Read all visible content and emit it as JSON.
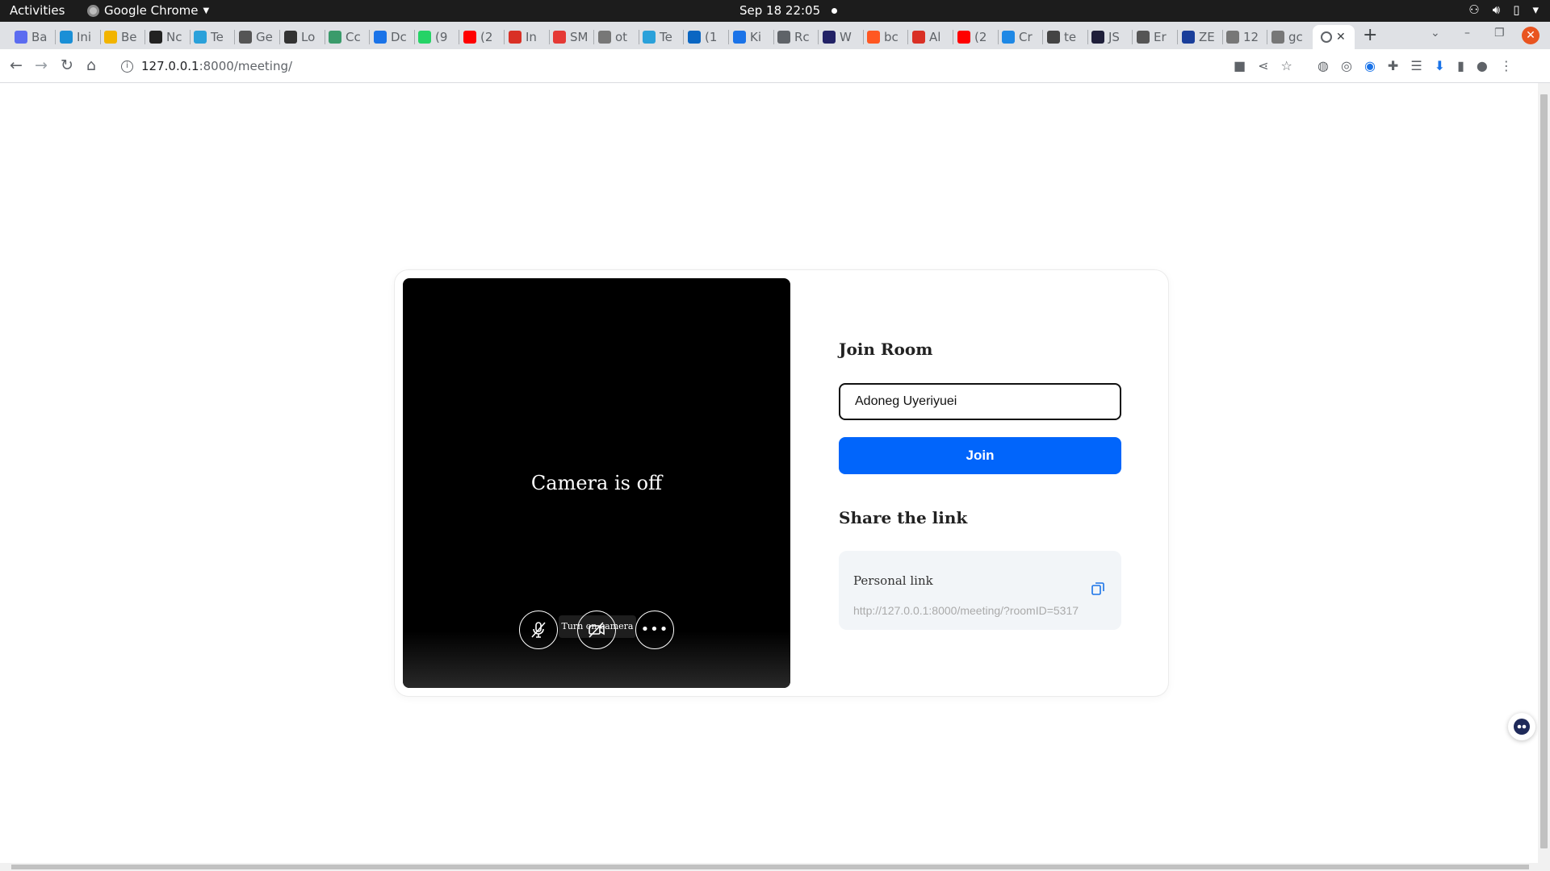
{
  "system": {
    "activities": "Activities",
    "app_name": "Google Chrome",
    "clock": "Sep 18  22:05"
  },
  "tabs": [
    {
      "label": "Ba",
      "color": "#5b6cf0"
    },
    {
      "label": "Ini",
      "color": "#1a8fd6"
    },
    {
      "label": "Be",
      "color": "#f2b400"
    },
    {
      "label": "Nc",
      "color": "#222222"
    },
    {
      "label": "Te",
      "color": "#2aa1da"
    },
    {
      "label": "Ge",
      "color": "#555555"
    },
    {
      "label": "Lo",
      "color": "#333333"
    },
    {
      "label": "Cc",
      "color": "#3a9b6b"
    },
    {
      "label": "Dc",
      "color": "#1a73e8"
    },
    {
      "label": "(9",
      "color": "#25d366"
    },
    {
      "label": "(2",
      "color": "#ff0000"
    },
    {
      "label": "In",
      "color": "#d93025"
    },
    {
      "label": "SM",
      "color": "#e53935"
    },
    {
      "label": "ot",
      "color": "#777777"
    },
    {
      "label": "Te",
      "color": "#2aa1da"
    },
    {
      "label": "(1",
      "color": "#0a66c2"
    },
    {
      "label": "Ki",
      "color": "#1a73e8"
    },
    {
      "label": "Rc",
      "color": "#5f6368"
    },
    {
      "label": "W",
      "color": "#222266"
    },
    {
      "label": "bc",
      "color": "#ff5722"
    },
    {
      "label": "Al",
      "color": "#d93025"
    },
    {
      "label": "(2",
      "color": "#ff0000"
    },
    {
      "label": "Cr",
      "color": "#1e88e5"
    },
    {
      "label": "te",
      "color": "#444444"
    },
    {
      "label": "JS",
      "color": "#1f1f3a"
    },
    {
      "label": "Er",
      "color": "#555555"
    },
    {
      "label": "ZE",
      "color": "#1a3e9a"
    },
    {
      "label": "12",
      "color": "#777777"
    },
    {
      "label": "gc",
      "color": "#777777"
    }
  ],
  "address_bar": {
    "host": "127.0.0.1",
    "path": ":8000/meeting/"
  },
  "meeting": {
    "camera_status": "Camera is off",
    "tooltip": "Turn on camera",
    "join_title": "Join Room",
    "name_value": "Adoneg Uyeriyuei",
    "join_button": "Join",
    "share_title": "Share the link",
    "personal_link_label": "Personal link",
    "personal_link_url": "http://127.0.0.1:8000/meeting/?roomID=5317"
  },
  "colors": {
    "join_button": "#0165fb",
    "copy_icon": "#1a73e8"
  }
}
